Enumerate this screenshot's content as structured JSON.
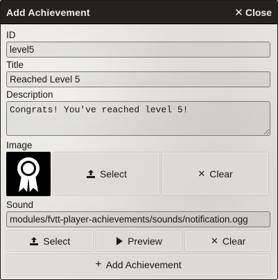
{
  "window": {
    "title": "Add Achievement",
    "close_label": "Close"
  },
  "form": {
    "id": {
      "label": "ID",
      "value": "level5"
    },
    "title": {
      "label": "Title",
      "value": "Reached Level 5"
    },
    "description": {
      "label": "Description",
      "value": "Congrats! You've reached level 5!"
    },
    "image": {
      "label": "Image",
      "icon": "award-ribbon-icon",
      "select_label": "Select",
      "clear_label": "Clear"
    },
    "sound": {
      "label": "Sound",
      "value": "modules/fvtt-player-achievements/sounds/notification.ogg",
      "select_label": "Select",
      "preview_label": "Preview",
      "clear_label": "Clear"
    },
    "submit_label": "Add Achievement"
  },
  "colors": {
    "titlebar": "#23221f",
    "window_bg": "#e6e4dc",
    "text": "#191813"
  }
}
